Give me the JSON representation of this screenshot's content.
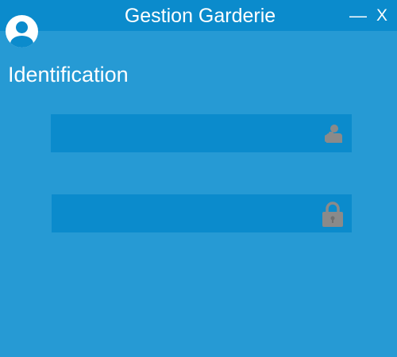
{
  "window": {
    "title": "Gestion Garderie",
    "minimize_label": "—",
    "close_label": "X"
  },
  "login": {
    "heading": "Identification",
    "username": {
      "value": "",
      "placeholder": "",
      "icon": "user-icon"
    },
    "password": {
      "value": "",
      "placeholder": "",
      "icon": "lock-icon"
    }
  },
  "colors": {
    "background": "#269ad4",
    "titlebar": "#0b8bcc",
    "field": "#0b8bcc",
    "icon": "#8a8a8a",
    "text": "#ffffff"
  }
}
